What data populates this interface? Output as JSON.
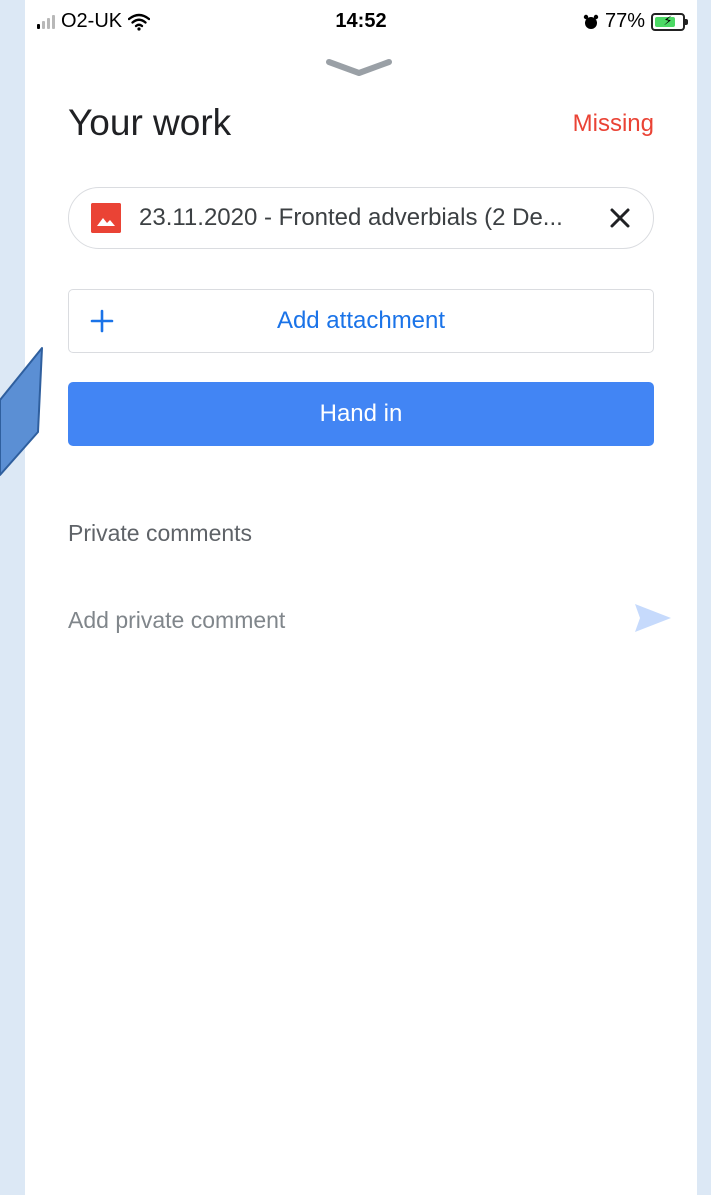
{
  "status_bar": {
    "carrier": "O2-UK",
    "time": "14:52",
    "battery_percent": "77%",
    "battery_level": 0.77,
    "icons": [
      "signal-icon",
      "wifi-icon",
      "alarm-icon",
      "battery-charging-icon"
    ]
  },
  "sheet": {
    "handle_icon": "chevron-down-icon",
    "title": "Your work",
    "status": "Missing",
    "status_color": "#ea4335"
  },
  "attachment": {
    "icon": "image-file-icon",
    "name": "23.11.2020 - Fronted adverbials (2 De...",
    "remove_icon": "close-icon"
  },
  "actions": {
    "add_attachment_label": "Add attachment",
    "add_icon": "plus-icon",
    "hand_in_label": "Hand in",
    "accent_color": "#4285f4"
  },
  "comments": {
    "heading": "Private comments",
    "placeholder": "Add private comment",
    "send_icon": "send-icon"
  }
}
